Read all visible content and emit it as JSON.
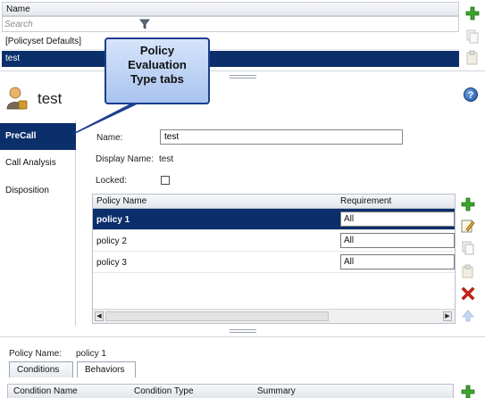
{
  "list": {
    "header": "Name",
    "search_placeholder": "Search",
    "rows": [
      "[Policyset Defaults]",
      "test"
    ]
  },
  "entity": {
    "title": "test"
  },
  "tabs": [
    "PreCall",
    "Call Analysis",
    "Disposition"
  ],
  "form": {
    "name_label": "Name:",
    "name_value": "test",
    "display_name_label": "Display Name:",
    "display_name_value": "test",
    "locked_label": "Locked:",
    "locked": false
  },
  "policy_grid": {
    "columns": [
      "Policy Name",
      "Requirement"
    ],
    "rows": [
      {
        "name": "policy 1",
        "requirement": "All",
        "selected": true
      },
      {
        "name": "policy 2",
        "requirement": "All",
        "selected": false
      },
      {
        "name": "policy 3",
        "requirement": "All",
        "selected": false
      }
    ]
  },
  "bottom": {
    "policy_name_label": "Policy Name:",
    "policy_name_value": "policy 1",
    "tabs": [
      "Conditions",
      "Behaviors"
    ],
    "columns": [
      "Condition Name",
      "Condition Type",
      "Summary"
    ]
  },
  "callout": {
    "lines": [
      "Policy",
      "Evaluation",
      "Type tabs"
    ]
  },
  "icons": {
    "add": "plus-icon",
    "edit": "edit-icon",
    "copy": "copy-icon",
    "paste": "paste-icon",
    "delete": "delete-icon",
    "move_up": "arrow-up-icon",
    "help": "help-icon",
    "filter": "filter-icon",
    "entity": "policy-user-icon"
  },
  "colors": {
    "selection": "#0b2f6b",
    "add_green": "#2f9a1f",
    "delete_red": "#d2221a",
    "callout_fill": "#b9d0f4",
    "callout_border": "#1c3f8d"
  }
}
